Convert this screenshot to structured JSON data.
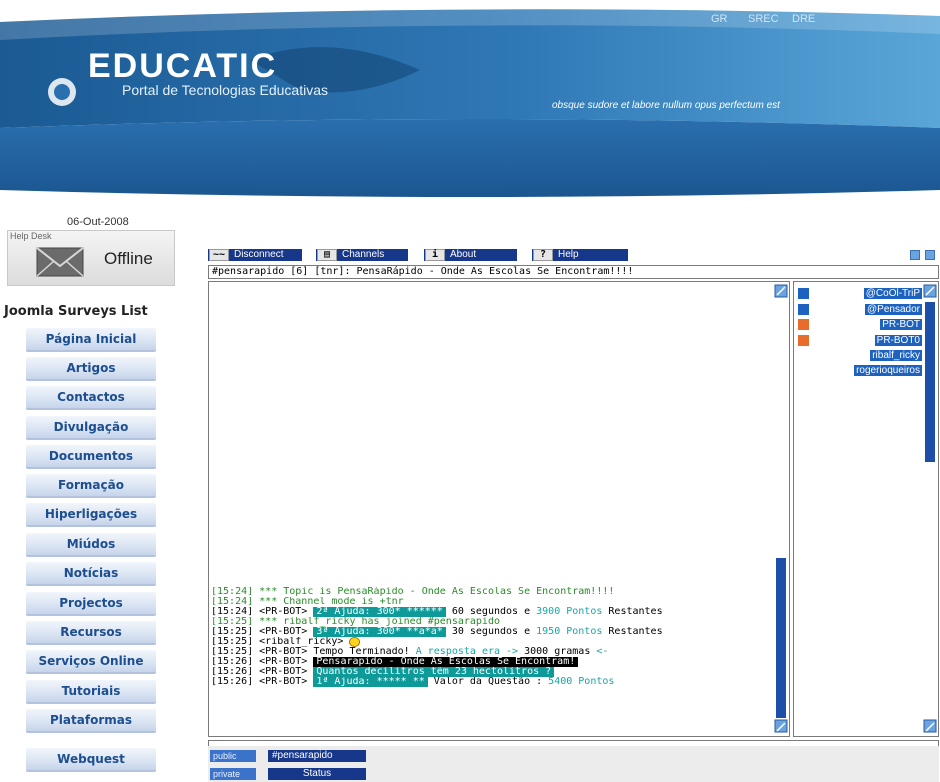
{
  "header": {
    "top_links": [
      "GR",
      "SREC",
      "DRE"
    ],
    "logo": "EDUCATIC",
    "subtitle": "Portal de Tecnologias Educativas",
    "motto": "obsque sudore et labore nullum opus perfectum est"
  },
  "sidebar": {
    "date": "06-Out-2008",
    "helpdesk_title": "Help Desk",
    "helpdesk_status": "Offline",
    "surveys_title": "Joomla Surveys List",
    "nav": [
      "Página Inicial",
      "Artigos",
      "Contactos",
      "Divulgação",
      "Documentos",
      "Formação",
      "Hiperligações",
      "Miúdos",
      "Notícias",
      "Projectos",
      "Recursos",
      "Serviços Online",
      "Tutoriais",
      "Plataformas",
      "Webquest"
    ]
  },
  "chat": {
    "toolbar": {
      "disconnect": "Disconnect",
      "channels": "Channels",
      "about": "About",
      "help": "Help"
    },
    "topic": "#pensarapido [6] [tnr]: PensaRápido - Onde As Escolas Se Encontram!!!!",
    "nicks": [
      "@CoOl-TriP",
      "@Pensador",
      "PR-BOT",
      "PR-BOT0",
      "ribalf_ricky",
      "rogerioqueiros"
    ],
    "messages": {
      "l1": "[15:24] *** Topic is PensaRápido - Onde As Escolas Se Encontram!!!!",
      "l2": "[15:24] *** Channel mode is +tnr",
      "l3_prefix": "[15:24] <PR-BOT>",
      "l3_hint": "2ª Ajuda: 300* ******",
      "l3_time": "60 segundos e",
      "l3_points": "3900 Pontos",
      "l3_suffix": "Restantes",
      "l4": "[15:25] *** ribalf_ricky has joined #pensarapido",
      "l5_prefix": "[15:25] <PR-BOT>",
      "l5_hint": "3ª Ajuda: 300* **a*a*",
      "l5_time": "30 segundos e",
      "l5_points": "1950 Pontos",
      "l5_suffix": "Restantes",
      "l6": "[15:25] <ribalf_ricky>",
      "l7_prefix": "[15:25] <PR-BOT> Tempo Terminado!",
      "l7_answer": "A resposta era ->",
      "l7_value": "3000 gramas",
      "l7_arrow": "<-",
      "l8_prefix": "[15:26] <PR-BOT>",
      "l8_banner": "Pensarapido - Onde As Escolas Se Encontram!",
      "l9_prefix": "[15:26] <PR-BOT>",
      "l9_question": "Quantos decilitros têm 23 hectolitros ?",
      "l10_prefix": "[15:26] <PR-BOT>",
      "l10_hint": "1ª Ajuda: ***** **",
      "l10_value": "Valor da Questão :",
      "l10_points": "5400 Pontos"
    },
    "tabs": {
      "public_label": "public",
      "channel": "#pensarapido",
      "private_label": "private",
      "status": "Status"
    }
  },
  "colors": {
    "banner_dark": "#1b5a93",
    "banner_light": "#4f9ad2",
    "nav_text": "#1d4e8f",
    "toolbar_bg": "#17378a",
    "system_msg": "#2a8c2a",
    "highlight_teal": "#0f9a9a",
    "nick_bg": "#1e62c0",
    "op_badge": "#e86c2c"
  }
}
